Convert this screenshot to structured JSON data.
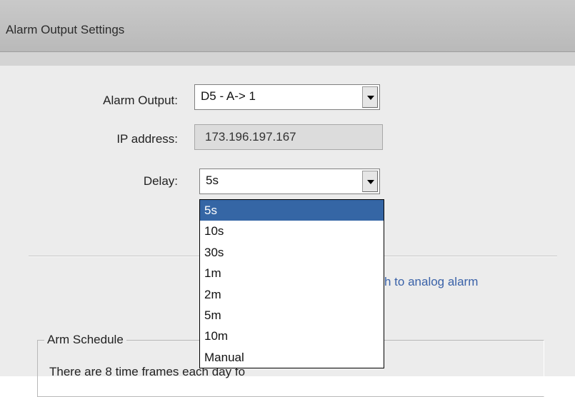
{
  "window": {
    "title": "Alarm Output Settings"
  },
  "form": {
    "alarm_output": {
      "label": "Alarm Output:",
      "value": "D5 - A-> 1"
    },
    "ip_address": {
      "label": "IP address:",
      "value": "173.196.197.167"
    },
    "delay": {
      "label": "Delay:",
      "value": "5s",
      "options": [
        "5s",
        "10s",
        "30s",
        "1m",
        "2m",
        "5m",
        "10m",
        "Manual"
      ],
      "selected_index": 0
    }
  },
  "switch_link": {
    "label": "itch to analog alarm"
  },
  "arm_schedule": {
    "title": "Arm Schedule",
    "note": "There are 8 time frames each day fo"
  },
  "colors": {
    "titlebar": "#c4c4c4",
    "panel": "#ececec",
    "selection": "#3566a5",
    "link": "#3a62a8"
  }
}
